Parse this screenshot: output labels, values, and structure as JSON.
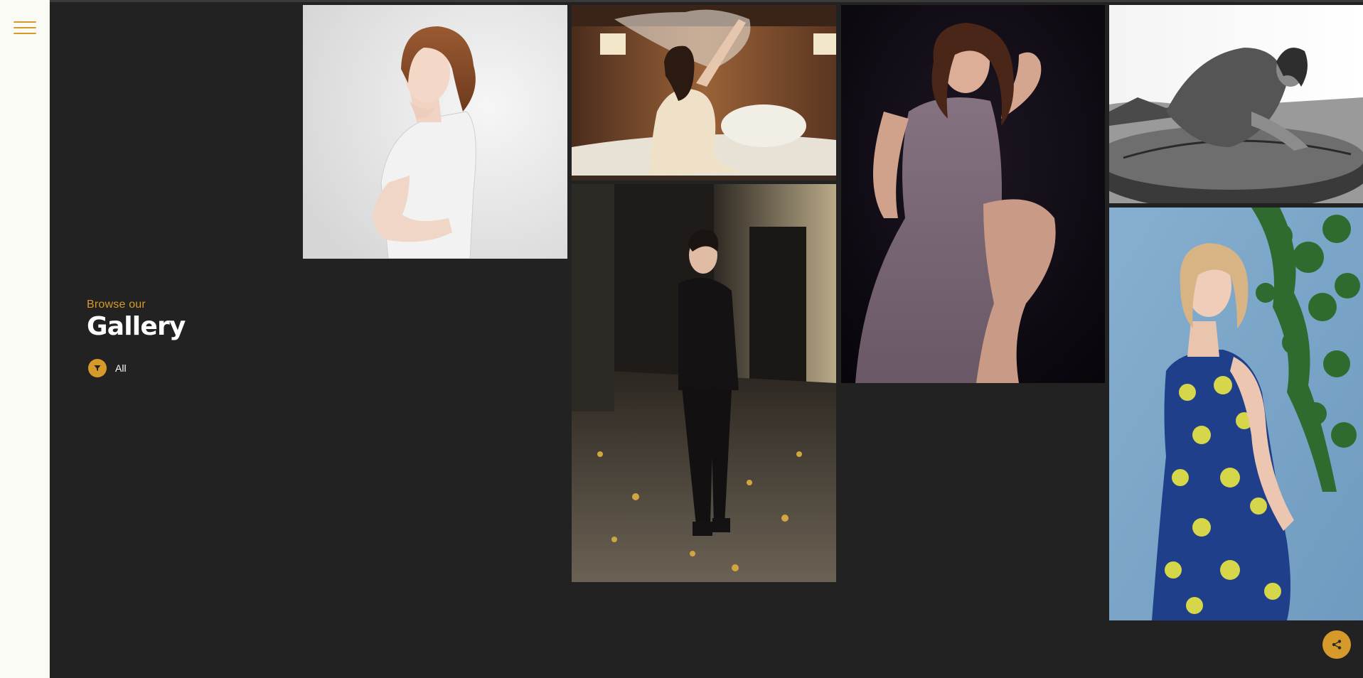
{
  "header": {
    "subtitle": "Browse our",
    "title": "Gallery"
  },
  "filter": {
    "label": "All",
    "icon": "filter-icon"
  },
  "menu": {
    "icon": "hamburger-menu-icon"
  },
  "share": {
    "icon": "share-icon"
  },
  "colors": {
    "accent": "#d69a2a",
    "background": "#222222",
    "sidebar": "#fbfbf6"
  },
  "gallery": {
    "items": [
      {
        "subject": "woman in white sleeveless top on light grey backdrop"
      },
      {
        "subject": "woman in cream dress on bed with sheer veil"
      },
      {
        "subject": "woman in black outfit standing in brick alley with autumn leaves"
      },
      {
        "subject": "woman in mauve dress seated against dark background"
      },
      {
        "subject": "woman sitting on hay bale in black and white field"
      },
      {
        "subject": "blonde woman in blue and yellow patterned dress by ivy wall"
      }
    ]
  }
}
